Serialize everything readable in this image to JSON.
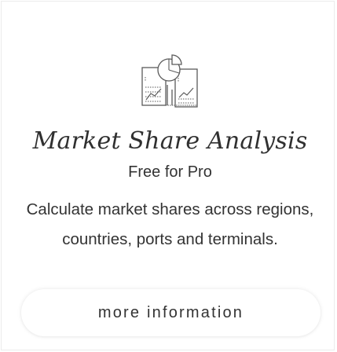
{
  "card": {
    "icon": "market-share-chart-icon",
    "title": "Market Share Analysis",
    "subtitle": "Free for Pro",
    "description_lines": [
      "Calculate market shares across regions,",
      "countries, ports and terminals."
    ],
    "more_button_label": "more information"
  }
}
